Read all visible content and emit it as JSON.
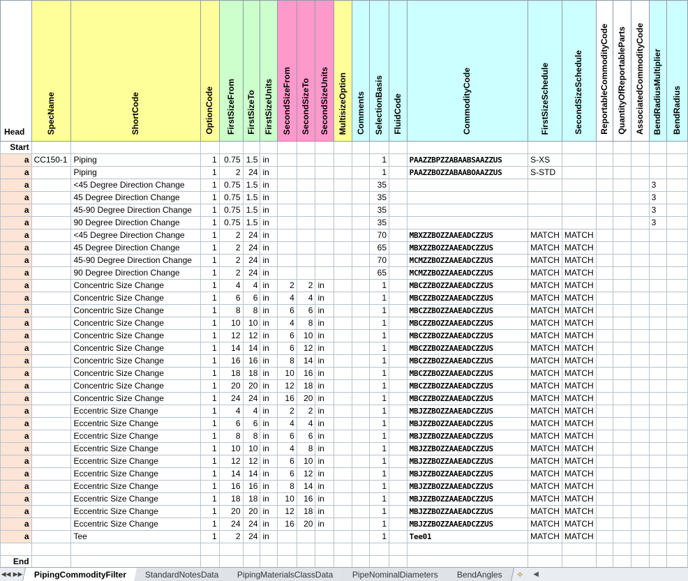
{
  "headers": [
    "SpecName",
    "ShortCode",
    "OptionCode",
    "FirstSizeFrom",
    "FirstSizeTo",
    "FirstSizeUnits",
    "SecondSizeFrom",
    "SecondSizeTo",
    "SecondSizeUnits",
    "MultisizeOption",
    "Comments",
    "SelectionBasis",
    "FluidCode",
    "CommodityCode",
    "FirstSizeSchedule",
    "SecondSizeSchedule",
    "ReportableCommodityCode",
    "QuantityOfReportableParts",
    "AssociatedCommodityCode",
    "BendRadiusMultiplier",
    "BendRadius"
  ],
  "row_labels": {
    "head": "Head",
    "start": "Start",
    "end": "End"
  },
  "rows": [
    [
      "a",
      "CC150-1",
      "Piping",
      "1",
      "0.75",
      "1.5",
      "in",
      "",
      "",
      "",
      "",
      "",
      "1",
      "",
      "PAAZZBPZZABAABSAAZZUS",
      "S-XS",
      "",
      "",
      "",
      "",
      "",
      ""
    ],
    [
      "a",
      "",
      "Piping",
      "1",
      "2",
      "24",
      "in",
      "",
      "",
      "",
      "",
      "",
      "1",
      "",
      "PAAZZBOZZABAABOAAZZUS",
      "S-STD",
      "",
      "",
      "",
      "",
      "",
      ""
    ],
    [
      "a",
      "",
      "<45 Degree Direction Change",
      "1",
      "0.75",
      "1.5",
      "in",
      "",
      "",
      "",
      "",
      "",
      "35",
      "",
      "",
      "",
      "",
      "",
      "",
      "",
      "3",
      ""
    ],
    [
      "a",
      "",
      "45 Degree Direction Change",
      "1",
      "0.75",
      "1.5",
      "in",
      "",
      "",
      "",
      "",
      "",
      "35",
      "",
      "",
      "",
      "",
      "",
      "",
      "",
      "3",
      ""
    ],
    [
      "a",
      "",
      "45-90 Degree Direction Change",
      "1",
      "0.75",
      "1.5",
      "in",
      "",
      "",
      "",
      "",
      "",
      "35",
      "",
      "",
      "",
      "",
      "",
      "",
      "",
      "3",
      ""
    ],
    [
      "a",
      "",
      "90 Degree Direction Change",
      "1",
      "0.75",
      "1.5",
      "in",
      "",
      "",
      "",
      "",
      "",
      "35",
      "",
      "",
      "",
      "",
      "",
      "",
      "",
      "3",
      ""
    ],
    [
      "a",
      "",
      "<45 Degree Direction Change",
      "1",
      "2",
      "24",
      "in",
      "",
      "",
      "",
      "",
      "",
      "70",
      "",
      "MBXZZBOZZAAEADCZZUS",
      "MATCH",
      "MATCH",
      "",
      "",
      "",
      "",
      ""
    ],
    [
      "a",
      "",
      "45 Degree Direction Change",
      "1",
      "2",
      "24",
      "in",
      "",
      "",
      "",
      "",
      "",
      "65",
      "",
      "MBXZZBOZZAAEADCZZUS",
      "MATCH",
      "MATCH",
      "",
      "",
      "",
      "",
      ""
    ],
    [
      "a",
      "",
      "45-90 Degree Direction Change",
      "1",
      "2",
      "24",
      "in",
      "",
      "",
      "",
      "",
      "",
      "70",
      "",
      "MCMZZBOZZAAEADCZZUS",
      "MATCH",
      "MATCH",
      "",
      "",
      "",
      "",
      ""
    ],
    [
      "a",
      "",
      "90 Degree Direction Change",
      "1",
      "2",
      "24",
      "in",
      "",
      "",
      "",
      "",
      "",
      "65",
      "",
      "MCMZZBOZZAAEADCZZUS",
      "MATCH",
      "MATCH",
      "",
      "",
      "",
      "",
      ""
    ],
    [
      "a",
      "",
      "Concentric Size Change",
      "1",
      "4",
      "4",
      "in",
      "2",
      "2",
      "in",
      "",
      "",
      "1",
      "",
      "MBCZZBOZZAAEADCZZUS",
      "MATCH",
      "MATCH",
      "",
      "",
      "",
      "",
      ""
    ],
    [
      "a",
      "",
      "Concentric Size Change",
      "1",
      "6",
      "6",
      "in",
      "4",
      "4",
      "in",
      "",
      "",
      "1",
      "",
      "MBCZZBOZZAAEADCZZUS",
      "MATCH",
      "MATCH",
      "",
      "",
      "",
      "",
      ""
    ],
    [
      "a",
      "",
      "Concentric Size Change",
      "1",
      "8",
      "8",
      "in",
      "6",
      "6",
      "in",
      "",
      "",
      "1",
      "",
      "MBCZZBOZZAAEADCZZUS",
      "MATCH",
      "MATCH",
      "",
      "",
      "",
      "",
      ""
    ],
    [
      "a",
      "",
      "Concentric Size Change",
      "1",
      "10",
      "10",
      "in",
      "4",
      "8",
      "in",
      "",
      "",
      "1",
      "",
      "MBCZZBOZZAAEADCZZUS",
      "MATCH",
      "MATCH",
      "",
      "",
      "",
      "",
      ""
    ],
    [
      "a",
      "",
      "Concentric Size Change",
      "1",
      "12",
      "12",
      "in",
      "6",
      "10",
      "in",
      "",
      "",
      "1",
      "",
      "MBCZZBOZZAAEADCZZUS",
      "MATCH",
      "MATCH",
      "",
      "",
      "",
      "",
      ""
    ],
    [
      "a",
      "",
      "Concentric Size Change",
      "1",
      "14",
      "14",
      "in",
      "6",
      "12",
      "in",
      "",
      "",
      "1",
      "",
      "MBCZZBOZZAAEADCZZUS",
      "MATCH",
      "MATCH",
      "",
      "",
      "",
      "",
      ""
    ],
    [
      "a",
      "",
      "Concentric Size Change",
      "1",
      "16",
      "16",
      "in",
      "8",
      "14",
      "in",
      "",
      "",
      "1",
      "",
      "MBCZZBOZZAAEADCZZUS",
      "MATCH",
      "MATCH",
      "",
      "",
      "",
      "",
      ""
    ],
    [
      "a",
      "",
      "Concentric Size Change",
      "1",
      "18",
      "18",
      "in",
      "10",
      "16",
      "in",
      "",
      "",
      "1",
      "",
      "MBCZZBOZZAAEADCZZUS",
      "MATCH",
      "MATCH",
      "",
      "",
      "",
      "",
      ""
    ],
    [
      "a",
      "",
      "Concentric Size Change",
      "1",
      "20",
      "20",
      "in",
      "12",
      "18",
      "in",
      "",
      "",
      "1",
      "",
      "MBCZZBOZZAAEADCZZUS",
      "MATCH",
      "MATCH",
      "",
      "",
      "",
      "",
      ""
    ],
    [
      "a",
      "",
      "Concentric Size Change",
      "1",
      "24",
      "24",
      "in",
      "16",
      "20",
      "in",
      "",
      "",
      "1",
      "",
      "MBCZZBOZZAAEADCZZUS",
      "MATCH",
      "MATCH",
      "",
      "",
      "",
      "",
      ""
    ],
    [
      "a",
      "",
      "Eccentric Size Change",
      "1",
      "4",
      "4",
      "in",
      "2",
      "2",
      "in",
      "",
      "",
      "1",
      "",
      "MBJZZBOZZAAEADCZZUS",
      "MATCH",
      "MATCH",
      "",
      "",
      "",
      "",
      ""
    ],
    [
      "a",
      "",
      "Eccentric Size Change",
      "1",
      "6",
      "6",
      "in",
      "4",
      "4",
      "in",
      "",
      "",
      "1",
      "",
      "MBJZZBOZZAAEADCZZUS",
      "MATCH",
      "MATCH",
      "",
      "",
      "",
      "",
      ""
    ],
    [
      "a",
      "",
      "Eccentric Size Change",
      "1",
      "8",
      "8",
      "in",
      "6",
      "6",
      "in",
      "",
      "",
      "1",
      "",
      "MBJZZBOZZAAEADCZZUS",
      "MATCH",
      "MATCH",
      "",
      "",
      "",
      "",
      ""
    ],
    [
      "a",
      "",
      "Eccentric Size Change",
      "1",
      "10",
      "10",
      "in",
      "4",
      "8",
      "in",
      "",
      "",
      "1",
      "",
      "MBJZZBOZZAAEADCZZUS",
      "MATCH",
      "MATCH",
      "",
      "",
      "",
      "",
      ""
    ],
    [
      "a",
      "",
      "Eccentric Size Change",
      "1",
      "12",
      "12",
      "in",
      "6",
      "10",
      "in",
      "",
      "",
      "1",
      "",
      "MBJZZBOZZAAEADCZZUS",
      "MATCH",
      "MATCH",
      "",
      "",
      "",
      "",
      ""
    ],
    [
      "a",
      "",
      "Eccentric Size Change",
      "1",
      "14",
      "14",
      "in",
      "6",
      "12",
      "in",
      "",
      "",
      "1",
      "",
      "MBJZZBOZZAAEADCZZUS",
      "MATCH",
      "MATCH",
      "",
      "",
      "",
      "",
      ""
    ],
    [
      "a",
      "",
      "Eccentric Size Change",
      "1",
      "16",
      "16",
      "in",
      "8",
      "14",
      "in",
      "",
      "",
      "1",
      "",
      "MBJZZBOZZAAEADCZZUS",
      "MATCH",
      "MATCH",
      "",
      "",
      "",
      "",
      ""
    ],
    [
      "a",
      "",
      "Eccentric Size Change",
      "1",
      "18",
      "18",
      "in",
      "10",
      "16",
      "in",
      "",
      "",
      "1",
      "",
      "MBJZZBOZZAAEADCZZUS",
      "MATCH",
      "MATCH",
      "",
      "",
      "",
      "",
      ""
    ],
    [
      "a",
      "",
      "Eccentric Size Change",
      "1",
      "20",
      "20",
      "in",
      "12",
      "18",
      "in",
      "",
      "",
      "1",
      "",
      "MBJZZBOZZAAEADCZZUS",
      "MATCH",
      "MATCH",
      "",
      "",
      "",
      "",
      ""
    ],
    [
      "a",
      "",
      "Eccentric Size Change",
      "1",
      "24",
      "24",
      "in",
      "16",
      "20",
      "in",
      "",
      "",
      "1",
      "",
      "MBJZZBOZZAAEADCZZUS",
      "MATCH",
      "MATCH",
      "",
      "",
      "",
      "",
      ""
    ],
    [
      "a",
      "",
      "Tee",
      "1",
      "2",
      "24",
      "in",
      "",
      "",
      "",
      "",
      "",
      "1",
      "",
      "Tee01",
      "MATCH",
      "MATCH",
      "",
      "",
      "",
      "",
      ""
    ]
  ],
  "tabs": [
    "PipingCommodityFilter",
    "StandardNotesData",
    "PipingMaterialsClassData",
    "PipeNominalDiameters",
    "BendAngles"
  ],
  "active_tab": "PipingCommodityFilter",
  "icons": {
    "nav_first": "first-sheet-icon",
    "nav_prev": "prev-sheet-icon",
    "nav_next": "next-sheet-icon",
    "nav_last": "last-sheet-icon",
    "new_sheet": "insert-sheet-icon"
  }
}
